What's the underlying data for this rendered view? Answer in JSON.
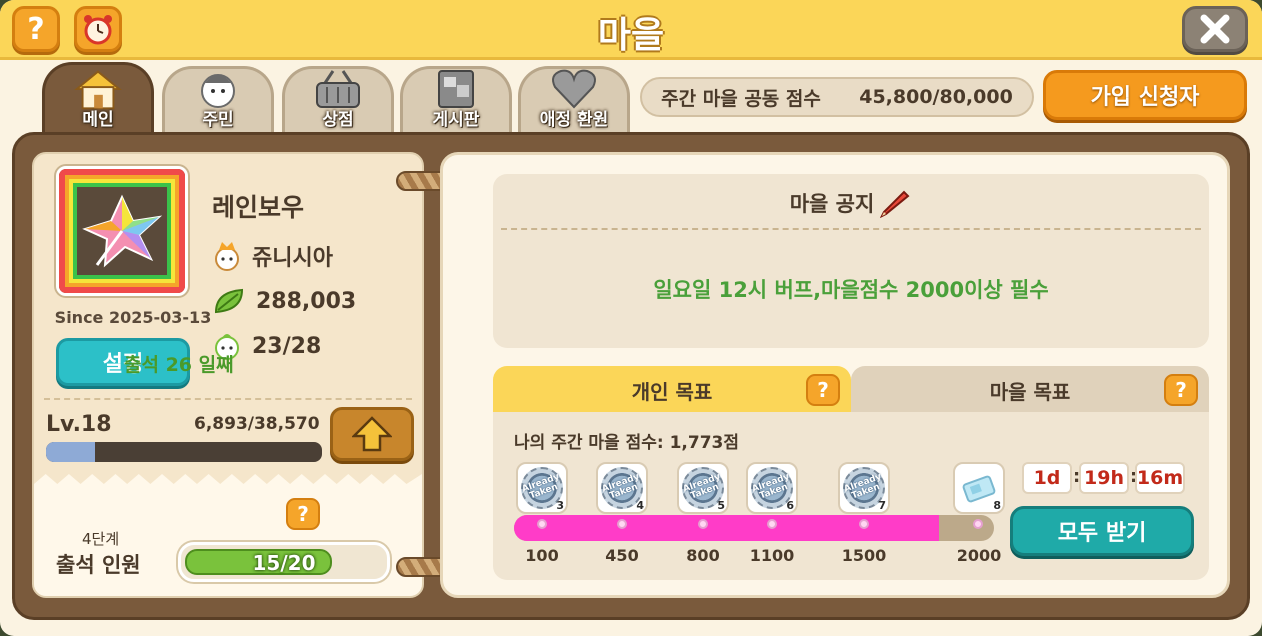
{
  "window": {
    "title": "마을"
  },
  "header": {
    "help_icon": "question-icon",
    "alarm_icon": "alarm-clock-icon",
    "close_icon": "close-icon"
  },
  "tabs": [
    {
      "label": "메인",
      "icon": "house-icon",
      "active": true
    },
    {
      "label": "주민",
      "icon": "resident-icon",
      "active": false
    },
    {
      "label": "상점",
      "icon": "basket-icon",
      "active": false
    },
    {
      "label": "게시판",
      "icon": "board-icon",
      "active": false
    },
    {
      "label": "애정 환원",
      "icon": "heart-icon",
      "active": false
    }
  ],
  "weekly_score": {
    "label": "주간 마을 공동 점수",
    "value": "45,800/80,000"
  },
  "join_button": "가입 신청자",
  "village": {
    "name": "레인보우",
    "leader": "쥬니시아",
    "points": "288,003",
    "members": "23/28",
    "since": "Since 2025-03-13",
    "settings_label": "설정"
  },
  "level": {
    "label": "Lv.18",
    "exp": "6,893/38,570",
    "exp_fraction": 0.178
  },
  "attendance": {
    "days": "출석 26 일째",
    "stage": "4단계",
    "label": "출석 인원",
    "count": "15/20",
    "fraction": 0.75
  },
  "notice": {
    "title": "마을 공지",
    "text": "일요일 12시 버프,마을점수 2000이상 필수"
  },
  "goal_tabs": {
    "personal": "개인 목표",
    "village": "마을 목표"
  },
  "personal_goal": {
    "score_text": "나의 주간 마을 점수: 1,773점",
    "progress_fraction": 0.886,
    "rewards": [
      {
        "mark": "100",
        "count": "3",
        "badge": "Already Taken"
      },
      {
        "mark": "450",
        "count": "4",
        "badge": "Already Taken"
      },
      {
        "mark": "800",
        "count": "5",
        "badge": "Already Taken"
      },
      {
        "mark": "1100",
        "count": "6",
        "badge": "Already Taken"
      },
      {
        "mark": "1500",
        "count": "7",
        "badge": "Already Taken"
      },
      {
        "mark": "2000",
        "count": "8",
        "badge": ""
      }
    ]
  },
  "timer": {
    "days": "1d",
    "hours": "19h",
    "minutes": "16m"
  },
  "claim_all": "모두 받기",
  "colors": {
    "header": "#fbd658",
    "board": "#7a5a3c",
    "accent_orange": "#f59a1e",
    "teal": "#1faaa8",
    "progress_pink": "#ff3cc8",
    "notice_green": "#4aa03a"
  }
}
